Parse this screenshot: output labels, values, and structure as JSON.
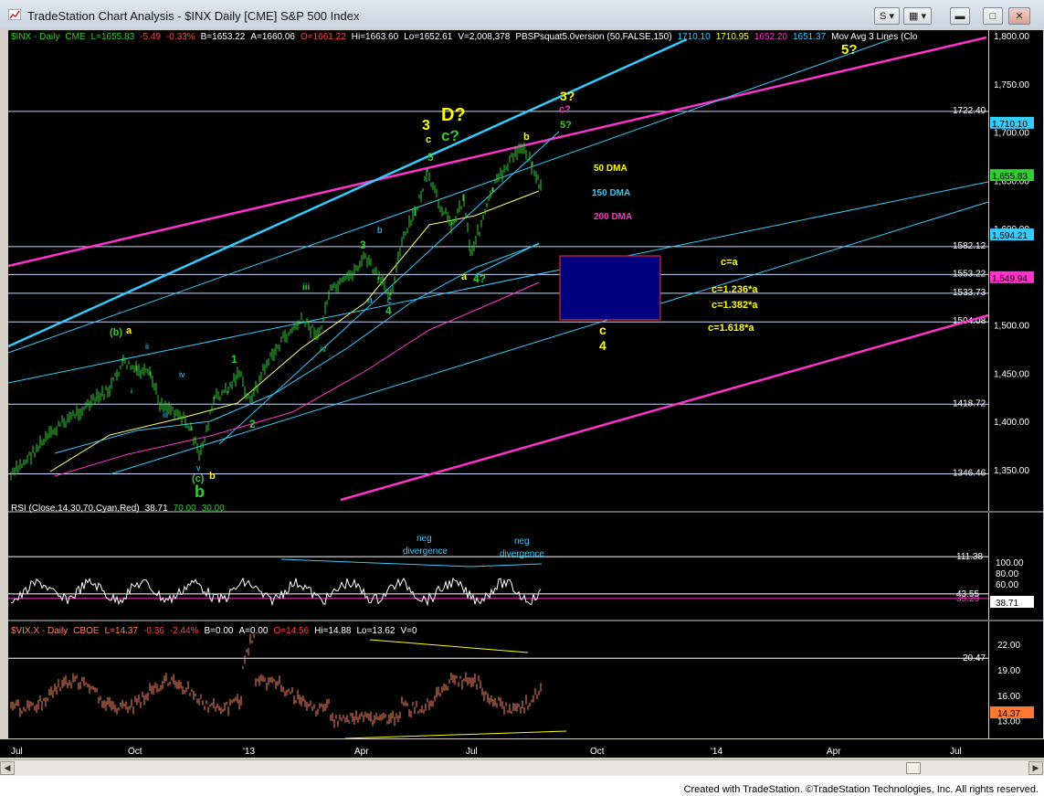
{
  "window": {
    "title": "TradeStation Chart Analysis - $INX Daily [CME] S&P 500 Index",
    "btn_s": "S",
    "btn_min": "▬",
    "btn_max": "□",
    "btn_close": "✕",
    "footer": "Created with TradeStation. ©TradeStation Technologies, Inc. All rights reserved."
  },
  "colors": {
    "bg": "#000000",
    "pink": "#ff33cc",
    "cyan": "#33ccff",
    "yellow": "#ffff00",
    "green": "#33cc33",
    "axis": "#ffffff"
  },
  "price_panel": {
    "header": [
      {
        "t": "$INX - Daily",
        "c": "#33cc33"
      },
      {
        "t": "CME",
        "c": "#33cc33"
      },
      {
        "t": "L=1655.83",
        "c": "#33cc33"
      },
      {
        "t": "-5.49",
        "c": "#ff4040"
      },
      {
        "t": "-0.33%",
        "c": "#ff4040"
      },
      {
        "t": "B=1653.22",
        "c": "#ffffff"
      },
      {
        "t": "A=1660.06",
        "c": "#ffffff"
      },
      {
        "t": "O=1661.22",
        "c": "#ff4040"
      },
      {
        "t": "Hi=1663.60",
        "c": "#ffffff"
      },
      {
        "t": "Lo=1652.61",
        "c": "#ffffff"
      },
      {
        "t": "V=2,008,378",
        "c": "#ffffff"
      },
      {
        "t": "PBSPsquat5.0version (50,FALSE,150)",
        "c": "#ffffff"
      },
      {
        "t": "1710.10",
        "c": "#33ccff"
      },
      {
        "t": "1710.95",
        "c": "#ffff00"
      },
      {
        "t": "1652.20",
        "c": "#ff33cc"
      },
      {
        "t": "1651.37",
        "c": "#33ccff"
      },
      {
        "t": "Mov Avg 3 Lines (Clo",
        "c": "#ffffff"
      }
    ],
    "y_ticks": [
      "1,800.00",
      "1,750.00",
      "1,700.00",
      "1,650.00",
      "1,600.00",
      "1,550.00",
      "1,500.00",
      "1,450.00",
      "1,400.00",
      "1,350.00"
    ],
    "levels": [
      "1722.40",
      "1582.12",
      "1553.22",
      "1533.73",
      "1504.08",
      "1418.72",
      "1346.46"
    ],
    "badges": [
      {
        "t": "1,710.10",
        "bg": "#33ccff",
        "fg": "#000000"
      },
      {
        "t": "1,655.83",
        "bg": "#33cc33",
        "fg": "#000000"
      },
      {
        "t": "1,594.21",
        "bg": "#33ccff",
        "fg": "#000000"
      },
      {
        "t": "1,549.94",
        "bg": "#ff33cc",
        "fg": "#000000"
      }
    ],
    "dma": [
      "50 DMA",
      "150 DMA",
      "200 DMA"
    ],
    "wave_labels": [
      "5?",
      "D?",
      "3",
      "c",
      "c?",
      "5",
      "3?",
      "c?",
      "5?",
      "b",
      "b",
      "3",
      "iii",
      "a",
      "c",
      "4",
      "a",
      "4?",
      "iv",
      "1",
      "2",
      "(b)",
      "a",
      "ii",
      "i",
      "iv",
      "iii",
      "v",
      "(c)",
      "b",
      "b",
      "c",
      "4"
    ],
    "fib": [
      "c=a",
      "c=1.236*a",
      "c=1.382*a",
      "c=1.618*a"
    ]
  },
  "rsi_panel": {
    "header": [
      {
        "t": "RSI (Close,14,30,70,Cyan,Red)",
        "c": "#ffffff"
      },
      {
        "t": "38.71",
        "c": "#ffffff"
      },
      {
        "t": "70.00",
        "c": "#33cc33"
      },
      {
        "t": "30.00",
        "c": "#33cc33"
      }
    ],
    "y_ticks": [
      "100.00",
      "80.00",
      "60.00"
    ],
    "levels": [
      "111.38",
      "43.55",
      "35.29"
    ],
    "badge": "38.71",
    "notes": [
      "neg",
      "divergence",
      "neg",
      "divergence"
    ]
  },
  "vix_panel": {
    "header": [
      {
        "t": "$VIX.X - Daily",
        "c": "#ff8060"
      },
      {
        "t": "CBOE",
        "c": "#ff8060"
      },
      {
        "t": "L=14.37",
        "c": "#ff8060"
      },
      {
        "t": "-0.36",
        "c": "#ff4040"
      },
      {
        "t": "-2.44%",
        "c": "#ff4040"
      },
      {
        "t": "B=0.00",
        "c": "#ffffff"
      },
      {
        "t": "A=0.00",
        "c": "#ffffff"
      },
      {
        "t": "O=14.56",
        "c": "#ff4040"
      },
      {
        "t": "Hi=14.88",
        "c": "#ffffff"
      },
      {
        "t": "Lo=13.62",
        "c": "#ffffff"
      },
      {
        "t": "V=0",
        "c": "#ffffff"
      }
    ],
    "y_ticks": [
      "22.00",
      "19.00",
      "16.00",
      "13.00"
    ],
    "levels": [
      "20.47"
    ],
    "badge": "14.37"
  },
  "x_axis": [
    "Jul",
    "Oct",
    "'13",
    "Apr",
    "Jul",
    "Oct",
    "'14",
    "Apr",
    "Jul"
  ]
}
